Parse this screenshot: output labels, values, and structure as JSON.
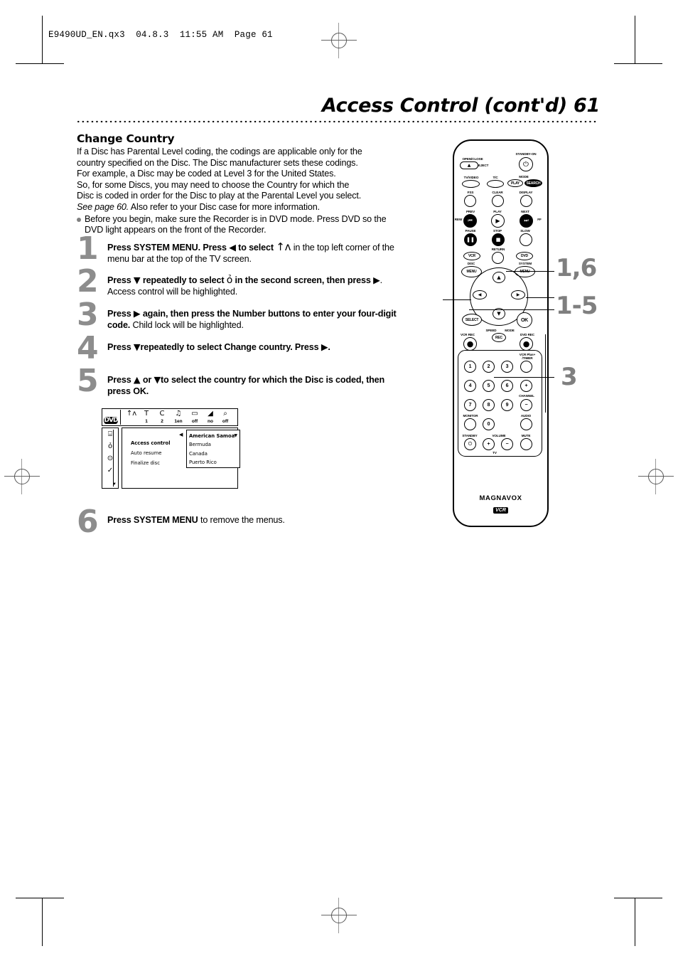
{
  "print": {
    "file_header": "E9490UD_EN.qx3  04.8.3  11:55 AM  Page 61"
  },
  "header": {
    "title": "Access Control (cont'd)  61"
  },
  "section": {
    "heading": "Change Country",
    "paragraph_lines": [
      "If a Disc has Parental Level coding, the codings are applicable only for the",
      "country specified on the Disc. The Disc manufacturer sets these codings.",
      "For example, a Disc may be coded at Level 3 for the United States.",
      "So, for some Discs, you may need to choose the Country for which the",
      "Disc is coded in order for the Disc to play at the Parental Level you select."
    ],
    "see_page_italic": "See page 60.",
    "see_page_rest": " Also refer to your Disc case for more information.",
    "bullet": "Before you begin, make sure the Recorder is in DVD mode. Press DVD so the DVD light appears on the front of the Recorder."
  },
  "steps": [
    {
      "number": "1",
      "bold_1": "Press SYSTEM MENU. Press ",
      "glyph_1": "◀",
      "bold_2": " to select ",
      "icon": "tv-antenna-icon",
      "icon_glyph": "↑ʌ",
      "normal": " in the top left corner of the menu bar at the top of the TV screen."
    },
    {
      "number": "2",
      "bold_1": "Press ",
      "glyph_1": "▼",
      "bold_2": " repeatedly to select ",
      "icon": "dvd-settings-icon",
      "icon_glyph": "ỏ",
      "bold_3": " in the second screen,  then press ",
      "glyph_2": "▶",
      "normal": ". Access control will be highlighted."
    },
    {
      "number": "3",
      "bold_1": "Press ",
      "glyph_1": "▶",
      "bold_2": " again, then press the Number buttons to enter your four-digit code.",
      "normal": " Child lock will be highlighted."
    },
    {
      "number": "4",
      "bold_1": "Press ",
      "glyph_1": "▼",
      "bold_2": "repeatedly to select Change country.  Press ",
      "glyph_2": "▶",
      "normal_bold_tail": "."
    },
    {
      "number": "5",
      "bold_1": "Press ",
      "glyph_1": "▲",
      "bold_2": " or ",
      "glyph_2": "▼",
      "bold_3": "to select the country for which the Disc is coded, then press OK."
    },
    {
      "number": "6",
      "bold_1": "Press SYSTEM MENU",
      "normal": " to remove the menus."
    }
  ],
  "osd": {
    "logo": "DVD",
    "menubar": [
      {
        "icon": "tv-antenna-icon",
        "glyph": "↑ʌ",
        "value": ""
      },
      {
        "icon": "subtitle-t-icon",
        "glyph": "T",
        "value": "1"
      },
      {
        "icon": "language-c-icon",
        "glyph": "C",
        "value": "2"
      },
      {
        "icon": "speaker-icon",
        "glyph": "♫",
        "value": "1en"
      },
      {
        "icon": "screen-icon",
        "glyph": "▭",
        "value": "off"
      },
      {
        "icon": "camera-angle-icon",
        "glyph": "◢",
        "value": "no"
      },
      {
        "icon": "zoom-icon",
        "glyph": "⌕",
        "value": "off"
      }
    ],
    "sidebar_icons": [
      {
        "name": "list-icon",
        "glyph": "⌸"
      },
      {
        "name": "dvd-settings-icon",
        "glyph": "ỏ"
      },
      {
        "name": "disc-icon",
        "glyph": "⊙"
      },
      {
        "name": "tools-icon",
        "glyph": "✓"
      }
    ],
    "menu_items": [
      {
        "label": "Access control",
        "selected": true
      },
      {
        "label": "Auto resume",
        "selected": false
      },
      {
        "label": "Finalize disc",
        "selected": false
      }
    ],
    "country_list": [
      "American Samoa",
      "Bermuda",
      "Canada",
      "Puerto Rico"
    ],
    "country_chevron": "▼",
    "left_arrow": "◀"
  },
  "remote": {
    "brand": "MAGNAVOX",
    "vcr_plus_logo": "VCR",
    "vcr_plus_suffix": "Plus+",
    "labels": {
      "open_close": "OPEN/CLOSE",
      "eject": "EJECT",
      "standby_on": "STANDBY-ON",
      "tv_video": "TV/VIDEO",
      "tc": "T/C",
      "mode": "MODE",
      "play": "PLAY",
      "search": "SEARCH",
      "fss": "FSS",
      "clear": "CLEAR",
      "display": "DISPLAY",
      "prev": "PREV",
      "play2": "PLAY",
      "next": "NEXT",
      "rew": "REW",
      "ff": "FF",
      "pause": "PAUSE",
      "stop": "STOP",
      "slow": "SLOW",
      "return": "RETURN",
      "vcr": "VCR",
      "dvd": "DVD",
      "disc": "DISC",
      "system": "SYSTEM",
      "menu_left": "MENU",
      "menu_right": "MENU",
      "select": "SELECT",
      "ok": "OK",
      "speed": "SPEED",
      "mode2": "MODE",
      "rec": "REC",
      "vcr_rec": "VCR REC",
      "dvd_rec": "DVD REC",
      "vcr_plus_timer_1": "VCR Plus+",
      "vcr_plus_timer_2": "/TIMER",
      "channel": "CHANNEL",
      "monitor": "MONITOR",
      "audio": "AUDIO",
      "standby": "STANDBY",
      "volume": "VOLUME",
      "mute": "MUTE",
      "tv": "TV"
    },
    "keys": [
      "1",
      "2",
      "3",
      "4",
      "5",
      "6",
      "7",
      "8",
      "9",
      "0"
    ],
    "plus": "+",
    "minus": "−"
  },
  "callouts": [
    {
      "name": "callout-system-menu",
      "label": "1,6"
    },
    {
      "name": "callout-cursor-keys",
      "label": "1-5"
    },
    {
      "name": "callout-number-keys",
      "label": "3"
    }
  ]
}
